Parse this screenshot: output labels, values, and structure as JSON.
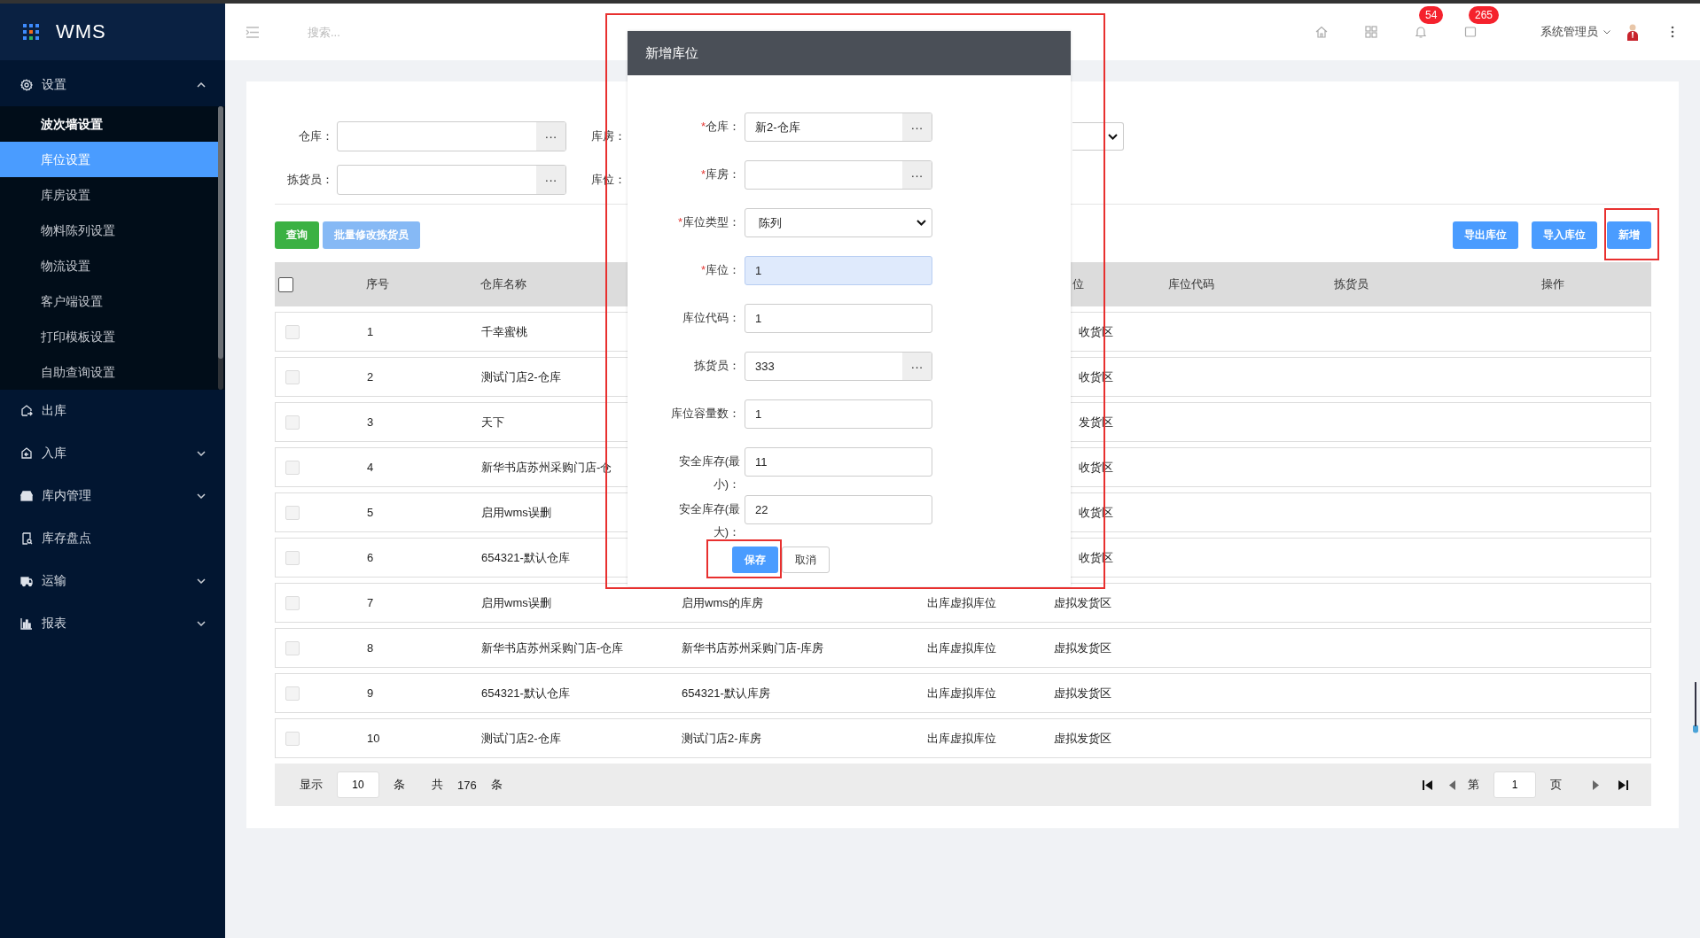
{
  "sidebar": {
    "logo": "WMS",
    "menu": [
      {
        "label": "设置",
        "expanded": true,
        "children": [
          {
            "label": "波次墙设置",
            "selected": false,
            "hovered": true
          },
          {
            "label": "库位设置",
            "selected": true,
            "hovered": false
          },
          {
            "label": "库房设置",
            "selected": false,
            "hovered": false
          },
          {
            "label": "物料陈列设置",
            "selected": false,
            "hovered": false
          },
          {
            "label": "物流设置",
            "selected": false,
            "hovered": false
          },
          {
            "label": "客户端设置",
            "selected": false,
            "hovered": false
          },
          {
            "label": "打印模板设置",
            "selected": false,
            "hovered": false
          },
          {
            "label": "自助查询设置",
            "selected": false,
            "hovered": false
          }
        ]
      },
      {
        "label": "出库"
      },
      {
        "label": "入库",
        "expanded": false
      },
      {
        "label": "库内管理",
        "expanded": false
      },
      {
        "label": "库存盘点"
      },
      {
        "label": "运输",
        "expanded": false
      },
      {
        "label": "报表",
        "expanded": false
      }
    ]
  },
  "topbar": {
    "search": {
      "placeholder": "搜索..."
    },
    "notifications": [
      {
        "badge": "54"
      },
      {
        "badge": "265"
      }
    ],
    "user": "系统管理员"
  },
  "filters": [
    [
      {
        "kind": "picker",
        "label": "仓库：",
        "button": "···"
      },
      {
        "kind": "covered",
        "label": "库房："
      },
      {
        "kind": "select"
      }
    ],
    [
      {
        "kind": "picker",
        "label": "拣货员：",
        "button": "···"
      },
      {
        "kind": "covered",
        "label": "库位："
      }
    ]
  ],
  "toolbar": {
    "left": [
      {
        "label": "查询",
        "kind": "success",
        "disabled": false,
        "highlighted": false
      },
      {
        "label": "批量修改拣货员",
        "kind": "primary",
        "disabled": true,
        "highlighted": false
      }
    ],
    "right": [
      {
        "label": "导出库位",
        "kind": "primary",
        "disabled": false,
        "highlighted": false
      },
      {
        "label": "导入库位",
        "kind": "primary",
        "disabled": false,
        "highlighted": false
      },
      {
        "label": "新增",
        "kind": "primary",
        "disabled": false,
        "highlighted": true
      }
    ]
  },
  "table": {
    "columns": [
      {
        "kind": "checkbox",
        "checked": false
      },
      {
        "kind": "text",
        "label": "序号"
      },
      {
        "kind": "text",
        "label": "仓库名称"
      },
      {
        "kind": "covered"
      },
      {
        "kind": "covered"
      },
      {
        "kind": "text",
        "label": "位",
        "cut": true
      },
      {
        "kind": "text",
        "label": "库位代码"
      },
      {
        "kind": "text",
        "label": "拣货员"
      },
      {
        "kind": "text",
        "label": "操作",
        "cut": false
      }
    ],
    "rows": [
      {
        "checked": false,
        "index": "1",
        "warehouse": "千幸蜜桃",
        "area": "收货区",
        "area_cut": true
      },
      {
        "checked": false,
        "index": "2",
        "warehouse": "测试门店2-仓库",
        "area": "收货区",
        "area_cut": true
      },
      {
        "checked": false,
        "index": "3",
        "warehouse": "天下",
        "area": "发货区",
        "area_cut": true
      },
      {
        "checked": false,
        "index": "4",
        "warehouse": "新华书店苏州采购门店-仓",
        "area": "收货区",
        "area_cut": true
      },
      {
        "checked": false,
        "index": "5",
        "warehouse": "启用wms误删",
        "area": "收货区",
        "area_cut": true
      },
      {
        "checked": false,
        "index": "6",
        "warehouse": "654321-默认仓库",
        "area": "收货区",
        "area_cut": true
      },
      {
        "checked": false,
        "index": "7",
        "warehouse": "启用wms误删",
        "room": "启用wms的库房",
        "type": "出库虚拟库位",
        "area": "虚拟发货区"
      },
      {
        "checked": false,
        "index": "8",
        "warehouse": "新华书店苏州采购门店-仓库",
        "room": "新华书店苏州采购门店-库房",
        "type": "出库虚拟库位",
        "area": "虚拟发货区"
      },
      {
        "checked": false,
        "index": "9",
        "warehouse": "654321-默认仓库",
        "room": "654321-默认库房",
        "type": "出库虚拟库位",
        "area": "虚拟发货区"
      },
      {
        "checked": false,
        "index": "10",
        "warehouse": "测试门店2-仓库",
        "room": "测试门店2-库房",
        "type": "出库虚拟库位",
        "area": "虚拟发货区"
      }
    ]
  },
  "pagination": {
    "show_label": "显示",
    "page_size": "10",
    "size_unit": "条",
    "total_label": "共",
    "total": "176",
    "total_unit": "条",
    "page_label": "第",
    "page": "1",
    "page_unit": "页"
  },
  "dialog": {
    "title": "新增库位",
    "highlighted": true,
    "fields": [
      {
        "required_mark": "*",
        "label": "仓库：",
        "kind": "picker",
        "value": "新2-仓库",
        "button": "···",
        "autofilled": false
      },
      {
        "required_mark": "*",
        "label": "库房：",
        "kind": "picker",
        "button": "···",
        "autofilled": false
      },
      {
        "required_mark": "*",
        "label": "库位类型：",
        "kind": "select",
        "value": "陈列"
      },
      {
        "required_mark": "*",
        "label": "库位：",
        "kind": "text",
        "value": "1",
        "autofilled": true
      },
      {
        "label": "库位代码：",
        "kind": "text",
        "value": "1",
        "autofilled": false
      },
      {
        "label": "拣货员：",
        "kind": "picker",
        "value": "333",
        "button": "···",
        "autofilled": false
      },
      {
        "label": "库位容量数：",
        "kind": "text",
        "value": "1",
        "autofilled": false
      },
      {
        "label": "安全库存(最小)：",
        "kind": "text",
        "value": "11",
        "autofilled": false
      },
      {
        "label": "安全库存(最大)：",
        "kind": "text",
        "value": "22",
        "autofilled": false
      }
    ],
    "buttons": [
      {
        "label": "保存",
        "kind": "primary",
        "highlighted": true
      },
      {
        "label": "取消",
        "kind": "default",
        "highlighted": false
      }
    ]
  }
}
